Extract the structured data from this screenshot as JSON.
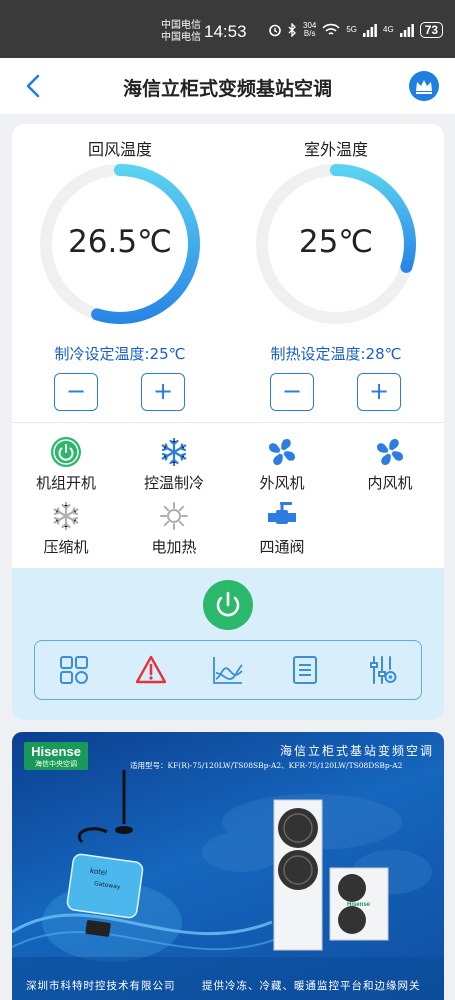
{
  "status_bar": {
    "carrier_1": "中国电信",
    "carrier_2": "中国电信",
    "time": "14:53",
    "net_speed_value": "304",
    "net_speed_unit": "B/s",
    "signal_1_label": "5G",
    "signal_2_label": "4G",
    "battery": "73"
  },
  "header": {
    "title": "海信立柜式变频基站空调",
    "back_icon": "chevron-left-icon",
    "vip_icon": "crown-icon"
  },
  "gauges": {
    "return_air": {
      "label": "回风温度",
      "value": "26.5℃",
      "level": 0.55
    },
    "outdoor": {
      "label": "室外温度",
      "value": "25℃",
      "level": 0.3
    }
  },
  "setpoints": {
    "cooling": {
      "label": "制冷设定温度:25℃",
      "minus": "−",
      "plus": "+"
    },
    "heating": {
      "label": "制热设定温度:28℃",
      "minus": "−",
      "plus": "+"
    }
  },
  "status_items": [
    {
      "label": "机组开机",
      "icon": "power-icon",
      "color": "#2cb86a"
    },
    {
      "label": "控温制冷",
      "icon": "snowflake-icon",
      "color": "#2d7de0"
    },
    {
      "label": "外风机",
      "icon": "fan-icon",
      "color": "#2d7de0"
    },
    {
      "label": "内风机",
      "icon": "fan-icon",
      "color": "#2d7de0"
    },
    {
      "label": "压缩机",
      "icon": "snowflake-icon",
      "color": "#b0b0b0"
    },
    {
      "label": "电加热",
      "icon": "heater-icon",
      "color": "#b0b0b0"
    },
    {
      "label": "四通阀",
      "icon": "valve-icon",
      "color": "#2d7de0"
    }
  ],
  "toolbar": {
    "icons": [
      "dashboard-icon",
      "alarm-icon",
      "chart-icon",
      "document-icon",
      "settings-sliders-icon"
    ]
  },
  "banner": {
    "brand": "Hisense",
    "brand_sub": "海信中央空调",
    "title": "海信立柜式基站变频空调",
    "models": "适用型号：KF(R)-75/120LW/TS08SBp-A2、KFR-75/120LW/TS08DSBp-A2",
    "company": "深圳市科特时控技术有限公司",
    "slogan": "提供冷冻、冷藏、暖通监控平台和边缘网关",
    "device_label": "Gateway",
    "device_brand": "kotel",
    "unit_brand": "Hisense"
  },
  "colors": {
    "accent": "#2d7de0",
    "gauge_start": "#2a86e6",
    "gauge_end": "#5ad2f0",
    "power_green": "#2cb86a",
    "alarm_red": "#e0333b",
    "panel_bg": "#d9eefb"
  }
}
